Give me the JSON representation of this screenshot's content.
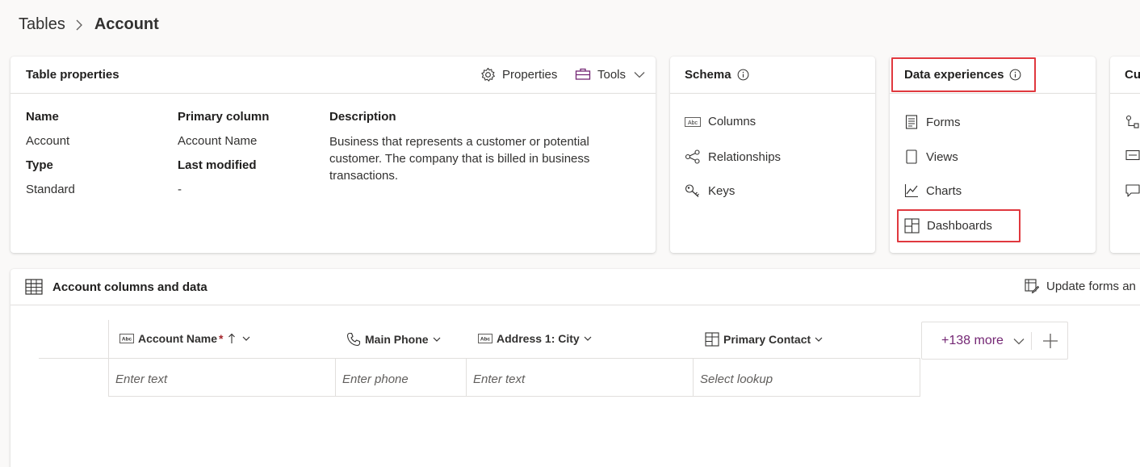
{
  "breadcrumb": {
    "parent": "Tables",
    "current": "Account"
  },
  "table_properties": {
    "title": "Table properties",
    "properties_label": "Properties",
    "tools_label": "Tools",
    "name_label": "Name",
    "name_value": "Account",
    "type_label": "Type",
    "type_value": "Standard",
    "primary_column_label": "Primary column",
    "primary_column_value": "Account Name",
    "last_modified_label": "Last modified",
    "last_modified_value": "-",
    "description_label": "Description",
    "description_value": "Business that represents a customer or potential customer. The company that is billed in business transactions."
  },
  "schema": {
    "title": "Schema",
    "items": [
      {
        "label": "Columns",
        "icon": "abc-text-icon"
      },
      {
        "label": "Relationships",
        "icon": "relationship-icon"
      },
      {
        "label": "Keys",
        "icon": "key-icon"
      }
    ]
  },
  "data_experiences": {
    "title": "Data experiences",
    "items": [
      {
        "label": "Forms",
        "icon": "form-icon"
      },
      {
        "label": "Views",
        "icon": "view-icon"
      },
      {
        "label": "Charts",
        "icon": "chart-icon"
      },
      {
        "label": "Dashboards",
        "icon": "dashboard-icon"
      }
    ],
    "highlight_color": "#e0383e"
  },
  "customizations": {
    "title_partial": "Cu"
  },
  "columns_grid": {
    "title": "Account columns and data",
    "update_forms_label": "Update forms an",
    "columns": [
      {
        "label": "Account Name",
        "required_marker": "*",
        "placeholder": "Enter text"
      },
      {
        "label": "Main Phone",
        "placeholder": "Enter phone"
      },
      {
        "label": "Address 1: City",
        "placeholder": "Enter text"
      },
      {
        "label": "Primary Contact",
        "placeholder": "Select lookup"
      }
    ],
    "more_columns_label": "+138 more"
  },
  "colors": {
    "accent": "#742774",
    "text": "#323130",
    "border": "#e1dfdd"
  }
}
